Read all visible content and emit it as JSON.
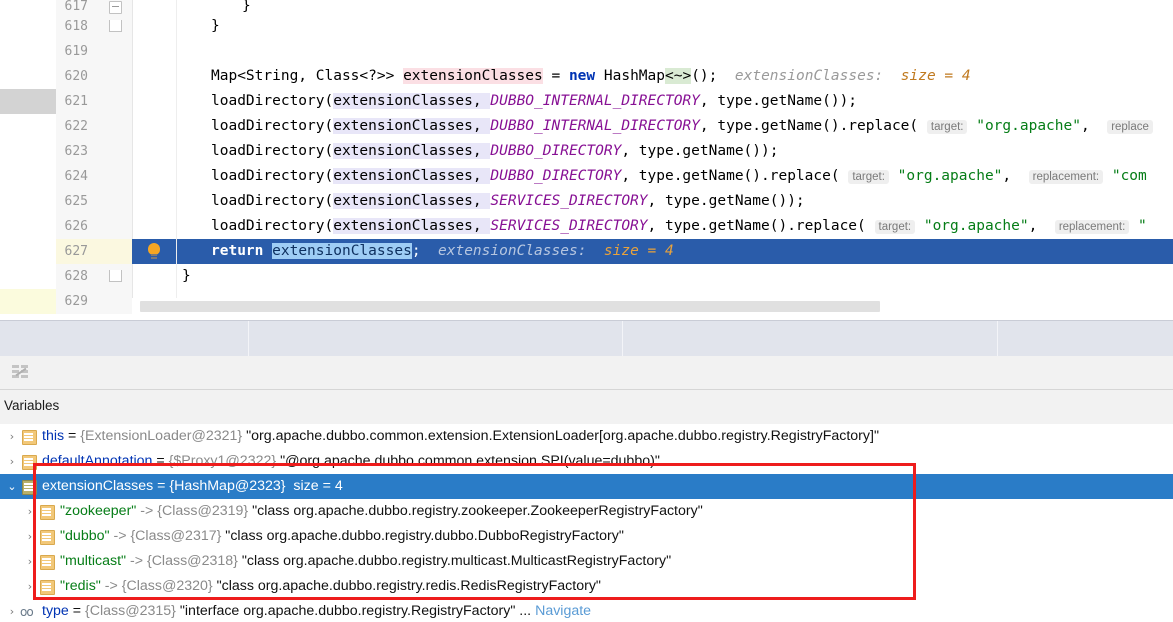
{
  "editor": {
    "line_numbers": [
      "617",
      "618",
      "619",
      "620",
      "621",
      "622",
      "623",
      "624",
      "625",
      "626",
      "627",
      "628",
      "629"
    ],
    "highlighted_line": "627",
    "breakpoint_line": "627",
    "lines": {
      "l617": "}",
      "l618": "}",
      "l619": "",
      "l620_a": "Map<String, Class<?>> ",
      "l620_b": "extensionClasses",
      "l620_c": " = ",
      "l620_kw": "new",
      "l620_d": " HashMap",
      "l620_gen": "<~>",
      "l620_e": "();",
      "l620_inlay": "extensionClasses:",
      "l620_inlay_num": "size = 4",
      "l621_a": "loadDirectory(",
      "l621_var": "extensionClasses",
      "l621_b": ", ",
      "l621_const": "DUBBO_INTERNAL_DIRECTORY",
      "l621_c": ", type.getName());",
      "l622_const": "DUBBO_INTERNAL_DIRECTORY",
      "l622_c": ", type.getName().replace(",
      "l622_hint1": "target:",
      "l622_str1": "\"org.apache\"",
      "l622_sep": ",",
      "l622_hint2": "replace",
      "l623_const": "DUBBO_DIRECTORY",
      "l623_c": ", type.getName());",
      "l624_const": "DUBBO_DIRECTORY",
      "l624_c": ", type.getName().replace(",
      "l624_hint1": "target:",
      "l624_str1": "\"org.apache\"",
      "l624_sep": ",",
      "l624_hint2": "replacement:",
      "l624_str2": "\"com",
      "l625_const": "SERVICES_DIRECTORY",
      "l625_c": ", type.getName());",
      "l626_const": "SERVICES_DIRECTORY",
      "l626_c": ", type.getName().replace(",
      "l626_hint1": "target:",
      "l626_str1": "\"org.apache\"",
      "l626_sep": ",",
      "l626_hint2": "replacement:",
      "l626_str2": "\"",
      "l627_kw": "return",
      "l627_var": "extensionClasses",
      "l627_semi": ";",
      "l627_inlay": "extensionClasses:",
      "l627_inlay_num": "size = 4",
      "l628": "}"
    },
    "icons": {
      "breakpoint": "breakpoint-verified-icon",
      "bulb": "intention-bulb-icon",
      "fold": "code-fold-icon"
    }
  },
  "toolbar": {
    "filter_icon": "hide-frames-icon"
  },
  "variables_panel": {
    "title": "Variables",
    "rows": [
      {
        "indent": 0,
        "chevron": "›",
        "icon": "object-field-icon",
        "name": "this",
        "eq": " = ",
        "ref": "{ExtensionLoader@2321}",
        "value": " \"org.apache.dubbo.common.extension.ExtensionLoader[org.apache.dubbo.registry.RegistryFactory]\"",
        "selected": false
      },
      {
        "indent": 0,
        "chevron": "›",
        "icon": "object-field-icon",
        "name": "defaultAnnotation",
        "eq": " = ",
        "ref": "{$Proxy1@2322}",
        "value": " \"@org.apache.dubbo.common.extension.SPI(value=dubbo)\"",
        "selected": false
      },
      {
        "indent": 0,
        "chevron": "⌄",
        "icon": "object-field-icon-olive",
        "name": "extensionClasses",
        "eq": " = ",
        "ref": "{HashMap@2323}",
        "value": "  size = 4",
        "selected": true
      },
      {
        "indent": 1,
        "chevron": "›",
        "icon": "map-entry-icon",
        "name": "\"zookeeper\"",
        "eq": " -> ",
        "ref": "{Class@2319}",
        "value": " \"class org.apache.dubbo.registry.zookeeper.ZookeeperRegistryFactory\"",
        "selected": false
      },
      {
        "indent": 1,
        "chevron": "›",
        "icon": "map-entry-icon",
        "name": "\"dubbo\"",
        "eq": " -> ",
        "ref": "{Class@2317}",
        "value": " \"class org.apache.dubbo.registry.dubbo.DubboRegistryFactory\"",
        "selected": false
      },
      {
        "indent": 1,
        "chevron": "›",
        "icon": "map-entry-icon",
        "name": "\"multicast\"",
        "eq": " -> ",
        "ref": "{Class@2318}",
        "value": " \"class org.apache.dubbo.registry.multicast.MulticastRegistryFactory\"",
        "selected": false
      },
      {
        "indent": 1,
        "chevron": "›",
        "icon": "map-entry-icon",
        "name": "\"redis\"",
        "eq": " -> ",
        "ref": "{Class@2320}",
        "value": " \"class org.apache.dubbo.registry.redis.RedisRegistryFactory\"",
        "selected": false
      },
      {
        "indent": 0,
        "chevron": "›",
        "icon": "static-field-icon",
        "name": "type",
        "eq": " = ",
        "ref": "{Class@2315}",
        "value": " \"interface org.apache.dubbo.registry.RegistryFactory\" ...",
        "link": "Navigate",
        "selected": false
      }
    ]
  },
  "annotation": {
    "shape": "red-rectangle",
    "color": "#ee1c1c"
  },
  "colors": {
    "selection_blue": "#2a7cc7",
    "code_selection_blue": "#2a5caa",
    "keyword": "#0033b3",
    "constant": "#871094",
    "string": "#067d17",
    "annotation_red": "#ee1c1c",
    "tabstrip": "#e1e4ec"
  }
}
